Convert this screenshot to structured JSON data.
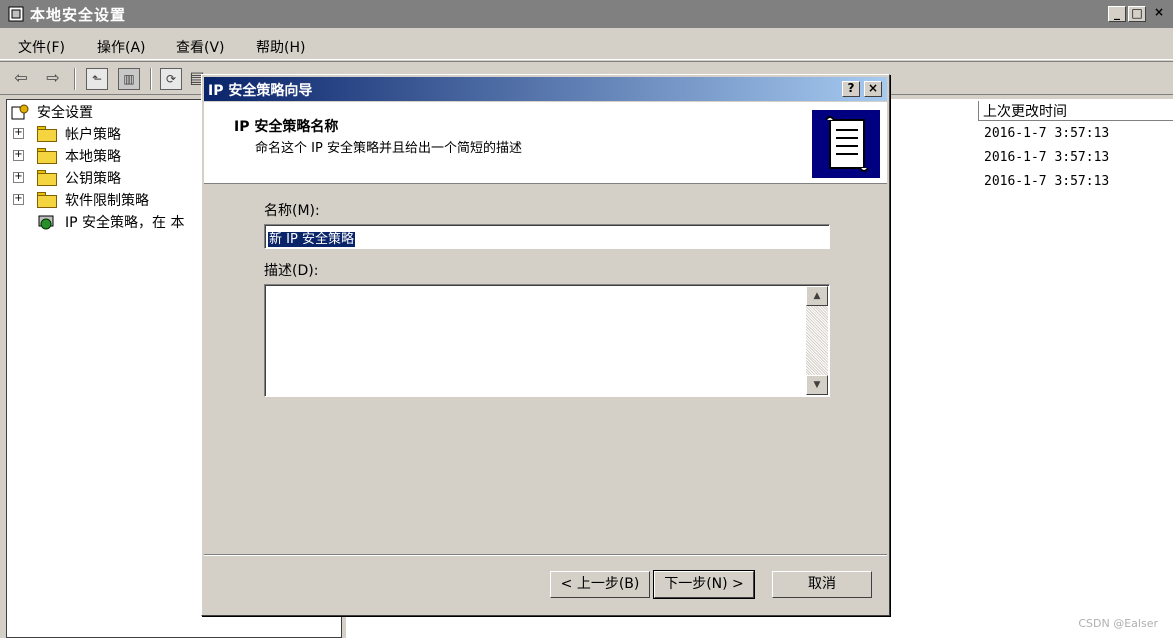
{
  "window": {
    "title": "本地安全设置",
    "controls": [
      "_",
      "□",
      "×"
    ]
  },
  "menu": [
    "文件(F)",
    "操作(A)",
    "查看(V)",
    "帮助(H)"
  ],
  "toolbar": {
    "icons": [
      "back-arrow-icon",
      "forward-arrow-icon",
      "up-folder-icon",
      "show-hide-tree-icon",
      "refresh-icon",
      "export-list-icon",
      "help-icon"
    ]
  },
  "tree": {
    "root": "安全设置",
    "items": [
      {
        "label": "帐户策略"
      },
      {
        "label": "本地策略"
      },
      {
        "label": "公钥策略"
      },
      {
        "label": "软件限制策略"
      },
      {
        "label": "IP 安全策略，在 本"
      }
    ]
  },
  "list": {
    "column_header": "上次更改时间",
    "rows": [
      "2016-1-7 3:57:13",
      "2016-1-7 3:57:13",
      "2016-1-7 3:57:13"
    ]
  },
  "dialog": {
    "title": "IP 安全策略向导",
    "header_title": "IP 安全策略名称",
    "header_subtitle": "命名这个 IP 安全策略并且给出一个简短的描述",
    "name_label": "名称(M):",
    "name_value": "新 IP 安全策略",
    "desc_label": "描述(D):",
    "desc_value": "",
    "buttons": {
      "back": "< 上一步(B)",
      "next": "下一步(N) >",
      "cancel": "取消"
    },
    "title_controls": [
      "?",
      "×"
    ]
  },
  "watermark": "CSDN @Ealser"
}
